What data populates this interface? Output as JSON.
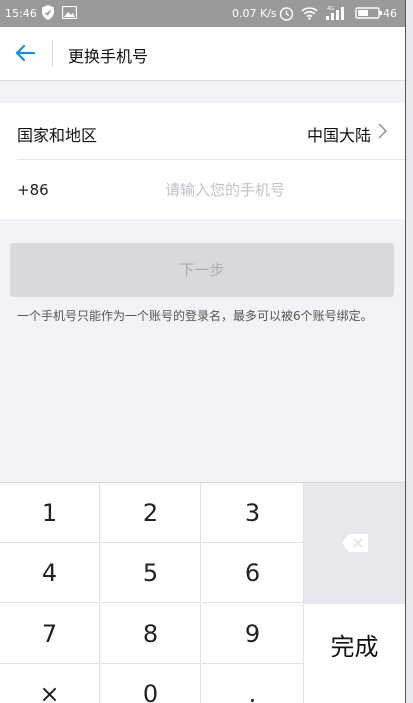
{
  "status_bar": {
    "time": "15:46",
    "speed": "0.07 K/s",
    "battery": "46"
  },
  "header": {
    "title": "更换手机号"
  },
  "form": {
    "region_label": "国家和地区",
    "region_value": "中国大陆",
    "country_code": "+86",
    "phone_placeholder": "请输入您的手机号",
    "phone_value": ""
  },
  "next_button": {
    "label": "下一步",
    "enabled": false
  },
  "hint": "一个手机号只能作为一个账号的登录名，最多可以被6个账号绑定。",
  "keypad": {
    "keys": [
      "1",
      "2",
      "3",
      "4",
      "5",
      "6",
      "7",
      "8",
      "9",
      "×",
      "0",
      "."
    ],
    "done_label": "完成"
  },
  "colors": {
    "accent": "#1a8fe0",
    "status_bar": "#9a9a9a",
    "disabled_button": "#d9d9dd"
  }
}
